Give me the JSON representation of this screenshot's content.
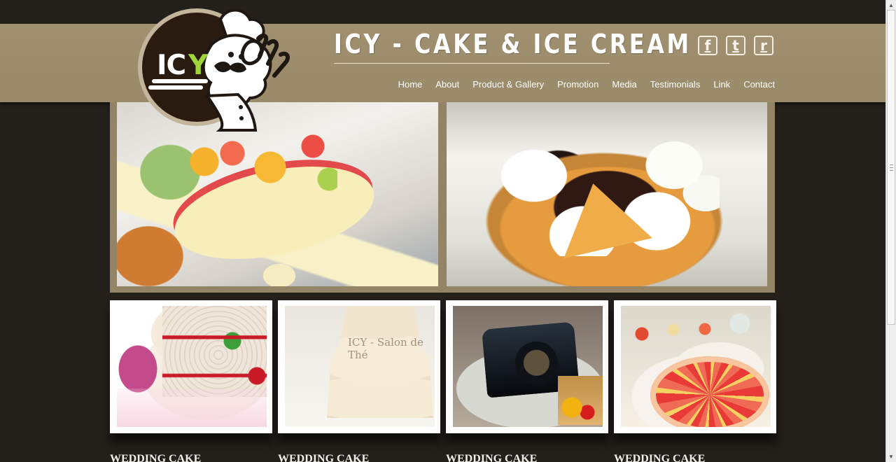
{
  "site": {
    "logo_text": "ICY",
    "title": "ICY - CAKE & ICE CREAM"
  },
  "social": [
    {
      "label": "f",
      "icon": "facebook-icon"
    },
    {
      "label": "t",
      "icon": "twitter-icon"
    },
    {
      "label": "r",
      "icon": "rss-icon"
    }
  ],
  "nav": [
    {
      "label": "Home"
    },
    {
      "label": "About"
    },
    {
      "label": "Product & Gallery"
    },
    {
      "label": "Promotion"
    },
    {
      "label": "Media"
    },
    {
      "label": "Testimonials"
    },
    {
      "label": "Link"
    },
    {
      "label": "Contact"
    }
  ],
  "hero": {
    "images": [
      {
        "name": "fruit crepe with green ice cream"
      },
      {
        "name": "chocolate crepe with whipped cream"
      }
    ]
  },
  "cards": [
    {
      "title": "WEDDING CAKE",
      "photo": "wedding cake with red ribbon"
    },
    {
      "title": "WEDDING CAKE",
      "photo": "tiered cream wedding cake",
      "watermark": "ICY - Salon de Thé"
    },
    {
      "title": "WEDDING CAKE",
      "photo": "camera shaped cake"
    },
    {
      "title": "WEDDING CAKE",
      "photo": "fruit tart"
    }
  ],
  "colors": {
    "background": "#231f1a",
    "header": "#a0906f",
    "hero_frame": "#938466",
    "text_light": "#ffffff"
  }
}
